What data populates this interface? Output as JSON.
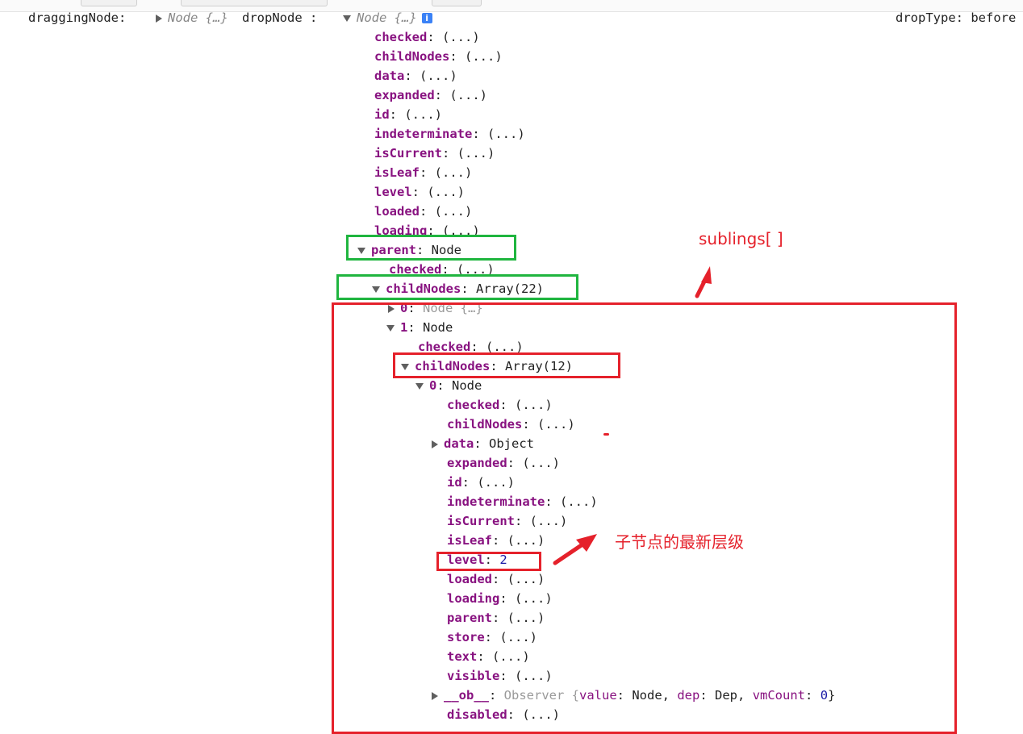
{
  "header": {
    "dragging_label": "draggingNode:",
    "dragging_value": "Node {…}",
    "drop_label": "dropNode :",
    "drop_value": "Node {…}",
    "drop_type_label": "dropType:",
    "drop_type_value": "before"
  },
  "tree": {
    "collapsed_value": "(...)",
    "node_value": "Node",
    "checked": "checked",
    "childNodes": "childNodes",
    "data": "data",
    "expanded": "expanded",
    "id": "id",
    "indeterminate": "indeterminate",
    "isCurrent": "isCurrent",
    "isLeaf": "isLeaf",
    "level": "level",
    "loaded": "loaded",
    "loading": "loading",
    "parent": "parent",
    "store": "store",
    "text": "text",
    "visible": "visible",
    "ob": "__ob__",
    "disabled": "disabled",
    "parent_childnodes_value": "Array(22)",
    "child_0_key": "0",
    "child_0_value": "Node {…}",
    "child_1_key": "1",
    "child_1_childnodes_value": "Array(12)",
    "grandchild_0_key": "0",
    "data_value": "Object",
    "level_value": "2",
    "ob_value_prefix": "Observer {",
    "ob_value_key": "value",
    "ob_value_val": "Node",
    "ob_dep_key": "dep",
    "ob_dep_val": "Dep",
    "ob_vmcount_key": "vmCount",
    "ob_vmcount_val": "0",
    "ob_value_suffix": "}"
  },
  "annotations": {
    "siblings": "sublings[ ]",
    "child_level": "子节点的最新层级"
  },
  "colors": {
    "property_key": "#881280",
    "green_box": "#1fb53f",
    "red_box": "#e5212b",
    "info_badge": "#3b82f6"
  }
}
